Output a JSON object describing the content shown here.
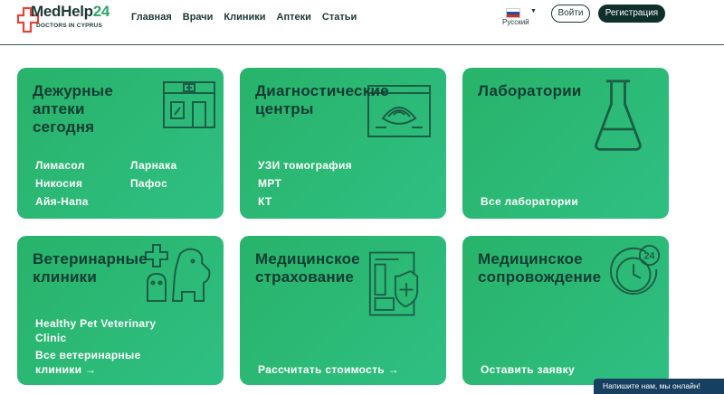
{
  "header": {
    "logo": {
      "brand_part1": "MedHelp",
      "brand_part2": "24",
      "tagline": "DOCTORS IN CYPRUS"
    },
    "nav": [
      {
        "label": "Главная"
      },
      {
        "label": "Врачи"
      },
      {
        "label": "Клиники"
      },
      {
        "label": "Аптеки"
      },
      {
        "label": "Статьи"
      }
    ],
    "language": {
      "selected": "Русский"
    },
    "login_label": "Войти",
    "register_label": "Регистрация"
  },
  "cards": {
    "pharmacies": {
      "title": [
        "Дежурные",
        "аптеки",
        "сегодня"
      ],
      "links": [
        "Лимасол",
        "Ларнака",
        "Никосия",
        "Пафос",
        "Айя-Напа"
      ],
      "icon": "pharmacy-building-icon"
    },
    "diagnostics": {
      "title": [
        "Диагностические",
        "центры"
      ],
      "links": [
        "УЗИ томография",
        "МРТ",
        "КТ"
      ],
      "icon": "ultrasound-monitor-icon"
    },
    "labs": {
      "title": [
        "Лаборатории"
      ],
      "links": [
        "Все лаборатории"
      ],
      "icon": "flask-icon"
    },
    "vets": {
      "title": [
        "Ветеринарные",
        "клиники"
      ],
      "links": [
        "Healthy Pet Veterinary",
        "Clinic",
        "Все ветеринарные",
        "клиники →"
      ],
      "icon": "pets-cross-icon"
    },
    "insurance": {
      "title": [
        "Медицинское",
        "страхование"
      ],
      "links": [
        "Рассчитать стоимость →"
      ],
      "icon": "insurance-document-icon"
    },
    "support": {
      "title": [
        "Медицинское",
        "сопровождение"
      ],
      "links": [
        "Оставить заявку"
      ],
      "icon": "clock-24-icon",
      "icon_text": "24"
    }
  },
  "chat": {
    "label": "Напишите нам, мы онлайн!"
  },
  "colors": {
    "card_green": "#2bb873",
    "dark_text": "#113c33",
    "brand_red": "#e0453a",
    "brand_green": "#2ea86c",
    "chat_blue": "#173f5f"
  }
}
